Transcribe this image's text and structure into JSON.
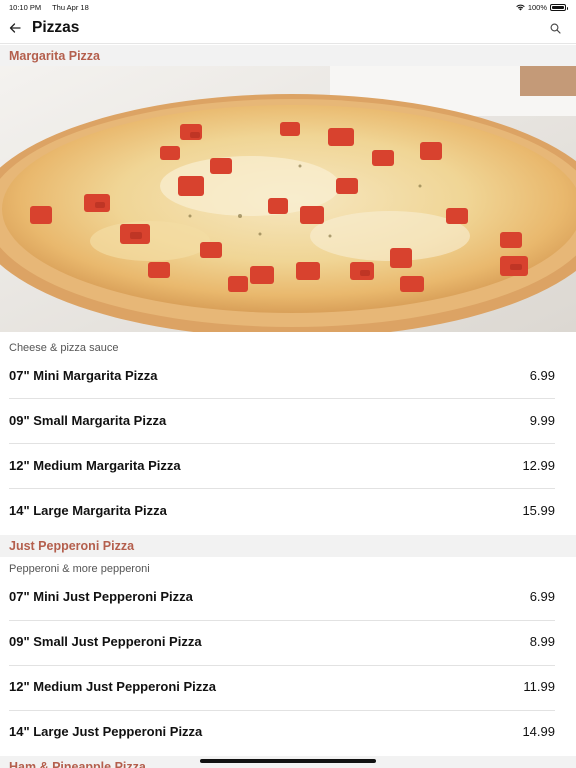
{
  "status_bar": {
    "time": "10:10 PM",
    "date": "Thu Apr 18",
    "battery": "100%"
  },
  "nav": {
    "title": "Pizzas",
    "back_icon": "arrow-left-icon",
    "search_icon": "search-icon"
  },
  "sections": [
    {
      "title": "Margarita Pizza",
      "description": "Cheese & pizza sauce",
      "items": [
        {
          "name": "07\" Mini Margarita Pizza",
          "price": "6.99"
        },
        {
          "name": "09\" Small Margarita Pizza",
          "price": "9.99"
        },
        {
          "name": "12\" Medium Margarita Pizza",
          "price": "12.99"
        },
        {
          "name": "14\" Large Margarita Pizza",
          "price": "15.99"
        }
      ]
    },
    {
      "title": "Just Pepperoni Pizza",
      "description": "Pepperoni & more pepperoni",
      "items": [
        {
          "name": "07\" Mini Just Pepperoni Pizza",
          "price": "6.99"
        },
        {
          "name": "09\" Small Just Pepperoni Pizza",
          "price": "8.99"
        },
        {
          "name": "12\" Medium Just Pepperoni Pizza",
          "price": "11.99"
        },
        {
          "name": "14\" Large Just Pepperoni Pizza",
          "price": "14.99"
        }
      ]
    },
    {
      "title": "Ham & Pineapple Pizza"
    }
  ],
  "colors": {
    "section_title": "#b45f4d",
    "section_bg": "#f2f2f2",
    "divider": "#e2e2e2"
  }
}
